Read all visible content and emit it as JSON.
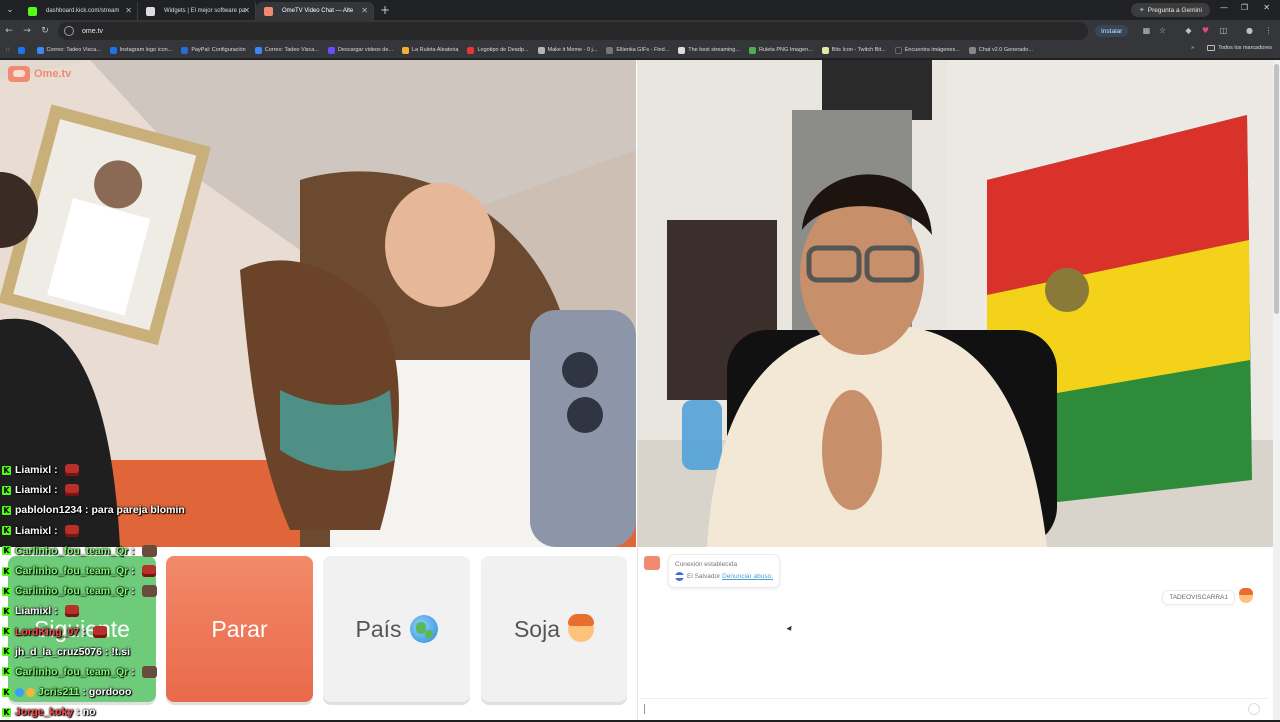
{
  "browser": {
    "tabs": [
      {
        "title": "dashboard.kick.com/stream",
        "favicon_color": "#53fc18",
        "active": false
      },
      {
        "title": "Widgets | El mejor software pa",
        "favicon_color": "#dddddd",
        "active": false
      },
      {
        "title": "OmeTV Video Chat — Alte",
        "favicon_color": "#f08a70",
        "active": true
      }
    ],
    "gemini_label": "Pregunta a Gemini",
    "url": "ome.tv",
    "install_label": "Instalar",
    "bookmarks": [
      {
        "label": "Correo: Tadeo Visca...",
        "color": "#4285f4"
      },
      {
        "label": "Instagram logo icon...",
        "color": "#1a73e8"
      },
      {
        "label": "PayPal: Configuración",
        "color": "#2a6ad6"
      },
      {
        "label": "Correo: Tadeo Visca...",
        "color": "#4285f4"
      },
      {
        "label": "Descargar videos de...",
        "color": "#6a4cff"
      },
      {
        "label": "La Ruleta Aleatoria",
        "color": "#f2b134"
      },
      {
        "label": "Logotipo de Deadp...",
        "color": "#e33"
      },
      {
        "label": "Make it Meme - 0 j...",
        "color": "#b5b5b5"
      },
      {
        "label": "Ellienka GIFs - Find...",
        "color": "#777"
      },
      {
        "label": "The best streaming...",
        "color": "#dddddd"
      },
      {
        "label": "Ruleta PNG Imagen...",
        "color": "#4caf50"
      },
      {
        "label": "Bits Icon - Twitch Bit...",
        "color": "#e8e8a0"
      },
      {
        "label": "Encuentra imágenes...",
        "color": "#333"
      },
      {
        "label": "Chat v2.0 Generado...",
        "color": "#888"
      }
    ],
    "all_bookmarks_label": "Todos los marcadores"
  },
  "ometv": {
    "logo_text": "Ome.tv",
    "buttons": {
      "next_label": "Siguiente",
      "stop_label": "Parar",
      "country_label": "País",
      "gender_label": "Soja"
    },
    "chat": {
      "system_title": "Conexión establecida",
      "system_country": "El Salvador",
      "report_label": "Denunciar abuso.",
      "my_message": "TADEOVISCARRA1"
    }
  },
  "stream_chat": [
    {
      "user": "Liamixl",
      "message": "",
      "user_color": "#ffffff",
      "emote": true
    },
    {
      "user": "Liamixl",
      "message": "",
      "user_color": "#ffffff",
      "emote": true
    },
    {
      "user": "pablolon1234",
      "message": "para pareja blomin",
      "user_color": "#ffffff",
      "emote": false
    },
    {
      "user": "Liamixl",
      "message": "",
      "user_color": "#ffffff",
      "emote": true
    },
    {
      "user": "Carlinho_fou_team_Qr",
      "message": "",
      "user_color": "#7dff6e",
      "emote": true
    },
    {
      "user": "Carlinho_fou_team_Qr",
      "message": "",
      "user_color": "#7dff6e",
      "emote": true
    },
    {
      "user": "Carlinho_fou_team_Qr",
      "message": "",
      "user_color": "#7dff6e",
      "emote": true
    },
    {
      "user": "Liamixl",
      "message": "",
      "user_color": "#ffffff",
      "emote": true
    },
    {
      "user": "LordKing_07",
      "message": "",
      "user_color": "#ff4a4a",
      "emote": true
    },
    {
      "user": "jh_d_la_cruz5076",
      "message": "!t.si",
      "user_color": "#ffffff",
      "emote": false
    },
    {
      "user": "Carlinho_fou_team_Qr",
      "message": "",
      "user_color": "#7dff6e",
      "emote": true
    },
    {
      "user": "Jcris211",
      "message": "gordooo",
      "user_color": "#7dff6e",
      "emote": false
    },
    {
      "user": "Jorge_koky",
      "message": "no",
      "user_color": "#ff4a4a",
      "emote": false
    }
  ]
}
